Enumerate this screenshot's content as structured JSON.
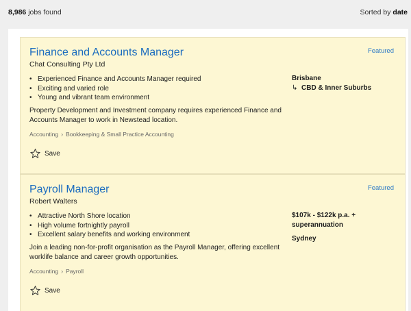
{
  "header": {
    "count": "8,986",
    "count_suffix": " jobs found",
    "sorted_prefix": "Sorted by ",
    "sorted_value": "date"
  },
  "jobs": [
    {
      "title": "Finance and Accounts Manager",
      "company": "Chat Consulting Pty Ltd",
      "badge": "Featured",
      "bullets": [
        "Experienced Finance and Accounts Manager required",
        "Exciting and varied role",
        "Young and vibrant team environment"
      ],
      "location": "Brisbane",
      "area": "CBD & Inner Suburbs",
      "description": "Property Development and Investment company requires experienced Finance and Accounts Manager to work in Newstead location.",
      "classification": "Accounting",
      "subclassification": "Bookkeeping & Small Practice Accounting",
      "save_label": "Save"
    },
    {
      "title": "Payroll Manager",
      "company": "Robert Walters",
      "badge": "Featured",
      "bullets": [
        "Attractive North Shore location",
        "High volume fortnightly payroll",
        "Excellent salary benefits and working environment"
      ],
      "salary_line1": "$107k - $122k p.a. +",
      "salary_line2": "superannuation",
      "location": "Sydney",
      "description": "Join a leading non-for-profit organisation as the Payroll Manager, offering excellent worklife balance and career growth opportunities.",
      "classification": "Accounting",
      "subclassification": "Payroll",
      "save_label": "Save"
    }
  ],
  "icons": {
    "save": "star-outline-icon",
    "subarea": "return-arrow-icon",
    "breadcrumb": "chevron-right-icon"
  },
  "colors": {
    "card_bg": "#fdf7d3",
    "link": "#1a6bbf",
    "badge": "#2a78c6"
  }
}
